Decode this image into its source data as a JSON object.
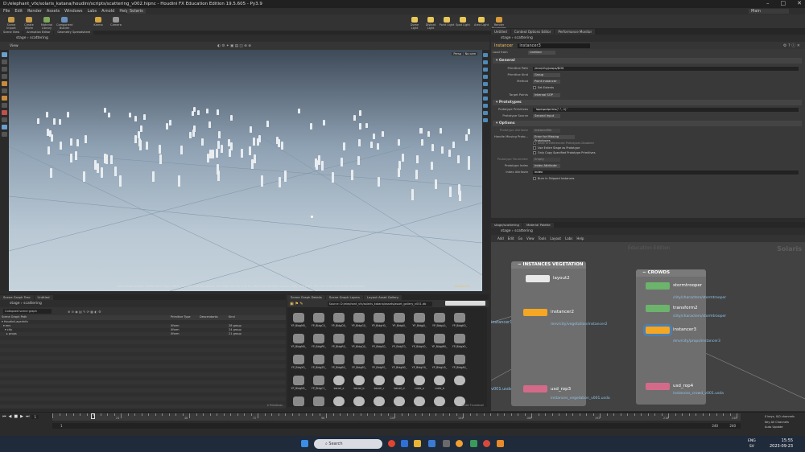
{
  "window": {
    "title": "D:/elephant_vfx/solaris_katana/houdini/scripts/scattering_v002.hipnc - Houdini FX Education Edition 19.5.605 - Py3.9"
  },
  "menu": {
    "items": [
      "File",
      "Edit",
      "Render",
      "Assets",
      "Windows",
      "Labs",
      "Arnold",
      "Help"
    ],
    "desktop": "Solaris",
    "main": "Main"
  },
  "shelf": {
    "tools": [
      "Scene Import",
      "Create Xform",
      "Material Library",
      "Component Builder",
      "Karma",
      "Camera",
      "Dome Light",
      "Distant Light",
      "Point Light",
      "Spot Light",
      "Area Light",
      "Render Properties"
    ]
  },
  "subtabs": [
    "Scene View",
    "Animation Editor",
    "Geometry Spreadsheet"
  ],
  "viewer": {
    "path": [
      "stage",
      "scattering"
    ],
    "tab": "View",
    "camera": "Persp",
    "menu": "No cam",
    "info": "Left mouse tumbles. Middle pans. Right dollies. Ctrl+Alt+Left box-zooms. Ctrl+Right for Ctrl+Left tilt. Hold L for alternate tumble, dolly, and zoom.    M or Alt+M for First Person Navigation.",
    "badge": "Houdini FX"
  },
  "parm": {
    "tabs": [
      "Untitled",
      "Context Options Editor",
      "Performance Monitor"
    ],
    "path": [
      "stage",
      "scattering"
    ],
    "node_type": "Instancer",
    "node_name": "instancer3",
    "load_from": "Load from",
    "load_from_value": "Untitled",
    "sections": {
      "general": "General",
      "prototypes": "Prototypes",
      "options": "Options"
    },
    "fields": {
      "primitive_path_label": "Primitive Path",
      "primitive_path": "/env/city/props/$OS",
      "primitive_kind_label": "Primitive Kind",
      "primitive_kind": "Group",
      "method_label": "Method",
      "method": "Point Instancer",
      "set_extents": "Set Extents",
      "target_points_label": "Target Points",
      "target_points": "Internal SOP",
      "prototype_primitives_label": "Prototype Primitives",
      "prototype_primitives": "`lopinputprims(\".\", 1)`",
      "prototype_source_label": "Prototype Source",
      "prototype_source": "Second Input",
      "proto_attr_label": "Prototype Attribute",
      "proto_attr": "instancefile",
      "handle_missing_label": "Handle Missing Proto...",
      "handle_missing": "Error for Missing Prototypes",
      "check1": "Keep Unreferenced Prototypes Disabled",
      "check2": "Use Entire Stage as Prototype",
      "check3": "Only Copy Specified Prototype Primitives",
      "proto_parm_label": "Prototype Parameter",
      "proto_parm": "Empty",
      "proto_index_label": "Prototype Index",
      "proto_index": "Index Attribute",
      "index_attr_label": "Index Attribute",
      "index_attr": "index",
      "check4": "Burn in Skipped Instances"
    }
  },
  "network": {
    "tabs": [
      "stage/scattering",
      "Material Palette"
    ],
    "path": [
      "stage",
      "scattering"
    ],
    "menu": [
      "Add",
      "Edit",
      "Go",
      "View",
      "Tools",
      "Layout",
      "Labs",
      "Help"
    ],
    "context_label": "Education Edition",
    "brand": "Solaris",
    "boxes": [
      {
        "title": "INSTANCES VEGETATION"
      },
      {
        "title": "CROWDS"
      }
    ],
    "nodes": [
      {
        "name": "layout2",
        "path": ""
      },
      {
        "name": "instancer2",
        "path": "/env/city/vegetation/instancer2"
      },
      {
        "name": "usd_rop3",
        "path": "instances_vegetation_v001.usda"
      },
      {
        "name": "stormtrooper",
        "path": "/city/characters/stormtrooper"
      },
      {
        "name": "transform2",
        "path": "/city/characters/stormtrooper"
      },
      {
        "name": "instancer3",
        "path": "/env/city/props/instancer3"
      },
      {
        "name": "usd_rop4",
        "path": "instances_crowd_v001.usda"
      }
    ],
    "edge_labels": [
      "instancer1",
      "v001.usda"
    ]
  },
  "tree": {
    "tabs": [
      "Scene Graph Tree",
      "Untitled"
    ],
    "path": [
      "stage",
      "scattering"
    ],
    "filter": "Collapsed scene graph",
    "columns": [
      "Scene Graph Path",
      "Primitive Type",
      "Descendants",
      "Kind"
    ],
    "rows": [
      {
        "name": "▾ HoudiniLayerInfo",
        "type": "",
        "desc": "",
        "kind": ""
      },
      {
        "name": "▾ env",
        "type": "Xform",
        "desc": "28 group",
        "kind": "28 group"
      },
      {
        "name": "  ▾ city",
        "type": "Xform",
        "desc": "24 group",
        "kind": "24 group"
      },
      {
        "name": "    ▸ props",
        "type": "Xform",
        "desc": "21 group",
        "kind": "21 group"
      }
    ],
    "footer": "4 Primitives"
  },
  "gallery": {
    "tabs": [
      "Scene Graph Details",
      "Scene Graph Layers",
      "Layout Asset Gallery"
    ],
    "source": "Source: D:/elephant_vfx/solaris_katana/assets/asset_gallery_v001.db",
    "items": [
      "YP_BldgM0_",
      "YP_BldgC0_",
      "YP_BldgD0_",
      "YP_BldgG0_",
      "YP_BldgH0_",
      "YP_BldgI0_",
      "YP_BldgJ0_",
      "YP_BldgL0_",
      "YP_BldgK0_",
      "YP_BldgM0_",
      "YP_BldgP0_",
      "YP_BldgR0_",
      "YP_BldgQ0_",
      "YP_BldgS0_",
      "YP_BldgT0_",
      "YP_BldgV0_",
      "YP_BldgW0_",
      "YP_BldgX0_",
      "YP_BldgY0_",
      "YP_BldgZ0_",
      "YP_BldgB0_",
      "YP_BldgE0_",
      "YP_BldgF0_",
      "YP_BldgN0_",
      "YP_BldgO0_",
      "YP_BldgU0_",
      "YP_BldgA0_",
      "YP_BldgM1_",
      "YP_BldgC1_",
      "barrel_a",
      "barrel_b",
      "barrel_c",
      "barrel_d",
      "crate_a",
      "crate_b",
      "",
      "",
      "",
      "",
      "",
      "",
      "",
      "",
      "",
      ""
    ],
    "footer": "Build Thumbnail"
  },
  "timeline": {
    "current_frame": "1",
    "start": "1",
    "end": "240",
    "end2": "240",
    "tick_labels": [
      "24",
      "48",
      "72",
      "96",
      "120",
      "144",
      "168",
      "192",
      "216",
      "240"
    ],
    "keys": [
      "0 keys, 0/0 channels",
      "Key All Channels",
      "Auto Update"
    ]
  },
  "taskbar": {
    "search": "Search",
    "lang": "ENG",
    "lang2": "SV",
    "time": "15:55",
    "date": "2023-09-23"
  }
}
